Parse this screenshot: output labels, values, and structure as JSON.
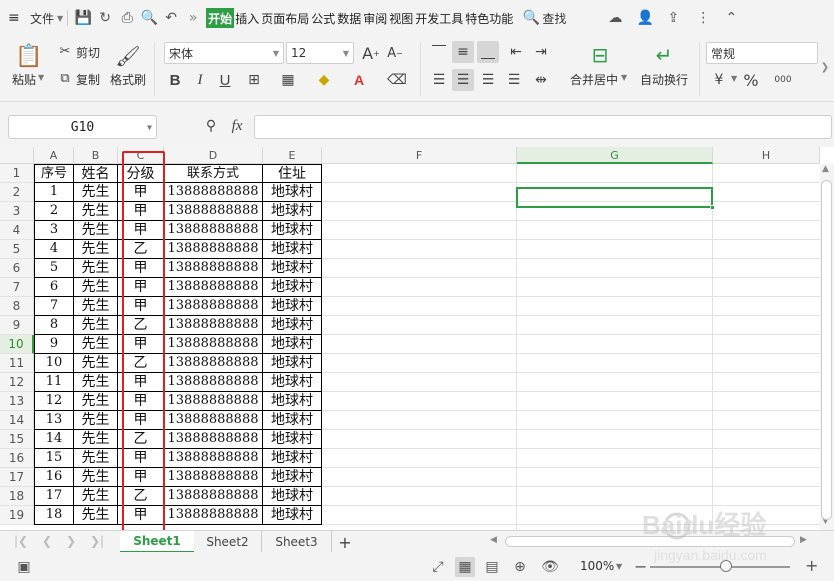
{
  "menu": {
    "file": "文件",
    "tabs": [
      "开始",
      "插入",
      "页面布局",
      "公式",
      "数据",
      "审阅",
      "视图",
      "开发工具",
      "特色功能"
    ],
    "search": "查找",
    "more": "»"
  },
  "ribbon": {
    "paste": "粘贴",
    "cut": "剪切",
    "copy": "复制",
    "format_painter": "格式刷",
    "font_name": "宋体",
    "font_size": "12",
    "bold": "B",
    "italic": "I",
    "underline": "U",
    "merge_center": "合并居中",
    "wrap_text": "自动换行",
    "number_format": "常规",
    "font_grow": "A",
    "font_shrink": "A",
    "percent": "%",
    "thousands": "000"
  },
  "formula_bar": {
    "name_box": "G10",
    "fx": "fx",
    "value": ""
  },
  "columns": [
    "A",
    "B",
    "C",
    "D",
    "E",
    "F",
    "G",
    "H"
  ],
  "selected_column": "G",
  "selected_row": "10",
  "row_numbers": [
    "1",
    "2",
    "3",
    "4",
    "5",
    "6",
    "7",
    "8",
    "9",
    "10",
    "11",
    "12",
    "13",
    "14",
    "15",
    "16",
    "17",
    "18",
    "19"
  ],
  "header_row": [
    "序号",
    "姓名",
    "分级",
    "联系方式",
    "住址"
  ],
  "rows": [
    [
      "1",
      "先生",
      "甲",
      "13888888888",
      "地球村"
    ],
    [
      "2",
      "先生",
      "甲",
      "13888888888",
      "地球村"
    ],
    [
      "3",
      "先生",
      "甲",
      "13888888888",
      "地球村"
    ],
    [
      "4",
      "先生",
      "乙",
      "13888888888",
      "地球村"
    ],
    [
      "5",
      "先生",
      "甲",
      "13888888888",
      "地球村"
    ],
    [
      "6",
      "先生",
      "甲",
      "13888888888",
      "地球村"
    ],
    [
      "7",
      "先生",
      "甲",
      "13888888888",
      "地球村"
    ],
    [
      "8",
      "先生",
      "乙",
      "13888888888",
      "地球村"
    ],
    [
      "9",
      "先生",
      "甲",
      "13888888888",
      "地球村"
    ],
    [
      "10",
      "先生",
      "乙",
      "13888888888",
      "地球村"
    ],
    [
      "11",
      "先生",
      "甲",
      "13888888888",
      "地球村"
    ],
    [
      "12",
      "先生",
      "甲",
      "13888888888",
      "地球村"
    ],
    [
      "13",
      "先生",
      "甲",
      "13888888888",
      "地球村"
    ],
    [
      "14",
      "先生",
      "乙",
      "13888888888",
      "地球村"
    ],
    [
      "15",
      "先生",
      "甲",
      "13888888888",
      "地球村"
    ],
    [
      "16",
      "先生",
      "甲",
      "13888888888",
      "地球村"
    ],
    [
      "17",
      "先生",
      "乙",
      "13888888888",
      "地球村"
    ],
    [
      "18",
      "先生",
      "甲",
      "13888888888",
      "地球村"
    ]
  ],
  "sheets": [
    "Sheet1",
    "Sheet2",
    "Sheet3"
  ],
  "active_sheet": "Sheet1",
  "add_sheet": "+",
  "status": {
    "zoom": "100%",
    "zoom_minus": "−",
    "zoom_plus": "+"
  },
  "watermark": {
    "brand": "Baidu经验",
    "url": "jingyan.baidu.com"
  },
  "colors": {
    "accent": "#2e9e46",
    "highlight": "#e02020"
  }
}
